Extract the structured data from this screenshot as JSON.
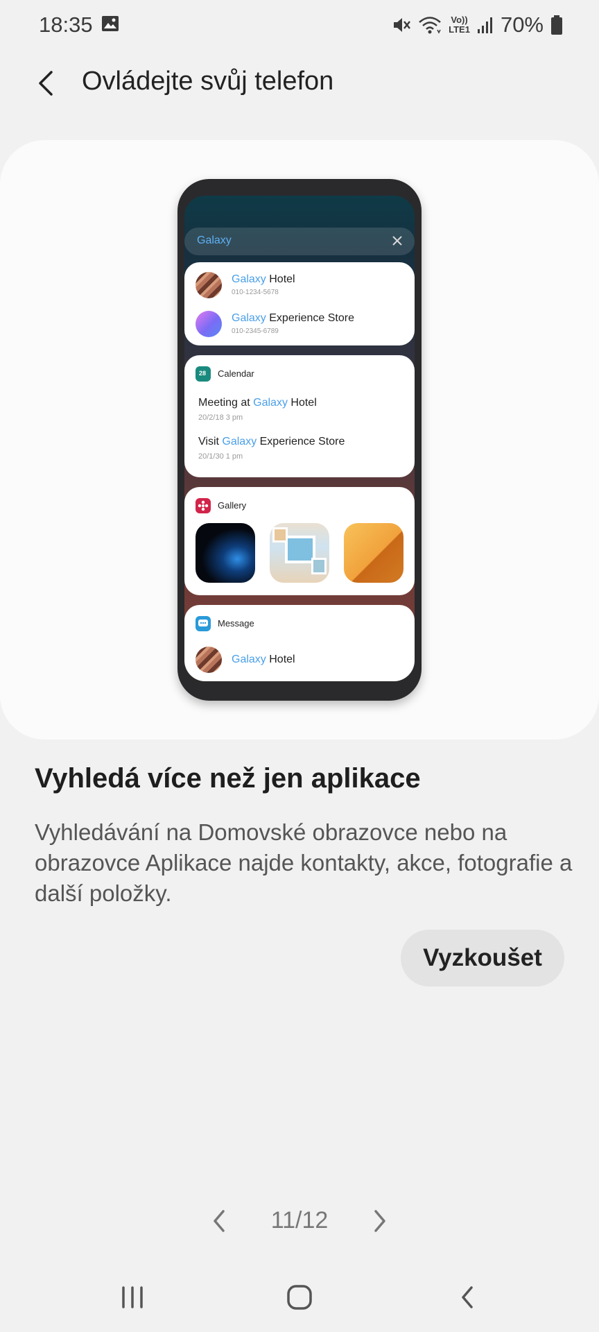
{
  "status_bar": {
    "time": "18:35",
    "lte_top": "Vo))",
    "lte_bottom": "LTE1",
    "battery": "70%"
  },
  "header": {
    "title": "Ovládejte svůj telefon"
  },
  "illustration": {
    "search_text": "Galaxy",
    "highlight_word": "Galaxy",
    "contacts": [
      {
        "name_rest": " Hotel",
        "number": "010-1234-5678"
      },
      {
        "name_rest": " Experience Store",
        "number": "010-2345-6789"
      }
    ],
    "calendar": {
      "app_name": "Calendar",
      "icon_text": "28",
      "events": [
        {
          "prefix": "Meeting at ",
          "suffix": " Hotel",
          "date": "20/2/18 3 pm"
        },
        {
          "prefix": "Visit ",
          "suffix": " Experience Store",
          "date": "20/1/30 1 pm"
        }
      ]
    },
    "gallery": {
      "app_name": "Gallery"
    },
    "message": {
      "app_name": "Message",
      "contact_rest": " Hotel"
    }
  },
  "main": {
    "heading": "Vyhledá více než jen aplikace",
    "description": "Vyhledávání na Domovské obrazovce nebo na obrazovce Aplikace najde kontakty, akce, fotografie a další položky.",
    "try_button": "Vyzkoušet"
  },
  "pager": {
    "page": "11/12"
  },
  "colors": {
    "background": "#f1f1f1",
    "card": "#fbfbfb",
    "highlight": "#4a9fe8",
    "calendar_icon": "#1a8a7e",
    "gallery_icon": "#d2234a",
    "message_icon": "#2a9ad9"
  }
}
